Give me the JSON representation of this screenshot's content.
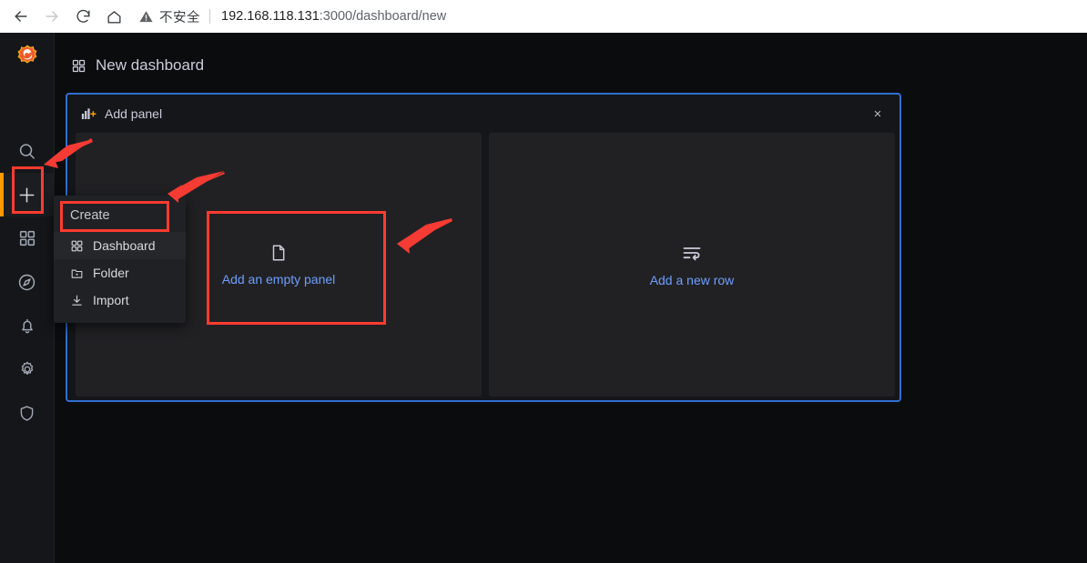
{
  "browser": {
    "back_icon": "arrow-left-icon",
    "forward_icon": "arrow-right-icon",
    "reload_icon": "reload-icon",
    "home_icon": "home-icon",
    "security_icon": "warning-triangle-icon",
    "security_label": "不安全",
    "url_host": "192.168.118.131",
    "url_port": ":3000",
    "url_path": "/dashboard/new",
    "url_full": "192.168.118.131:3000/dashboard/new"
  },
  "sidebar": {
    "brand": "grafana-logo",
    "items": [
      {
        "name": "search",
        "icon": "search-icon",
        "label": "Search",
        "active": false
      },
      {
        "name": "create",
        "icon": "plus-icon",
        "label": "Create",
        "active": true
      },
      {
        "name": "dashboards",
        "icon": "apps-grid-icon",
        "label": "Dashboards",
        "active": false
      },
      {
        "name": "explore",
        "icon": "compass-icon",
        "label": "Explore",
        "active": false
      },
      {
        "name": "alerting",
        "icon": "bell-icon",
        "label": "Alerting",
        "active": false
      },
      {
        "name": "configuration",
        "icon": "gear-icon",
        "label": "Configuration",
        "active": false
      },
      {
        "name": "server-admin",
        "icon": "shield-icon",
        "label": "Server Admin",
        "active": false
      }
    ]
  },
  "dashboard": {
    "icon": "apps-grid-icon",
    "title": "New dashboard"
  },
  "add_panel": {
    "icon": "bar-chart-plus-icon",
    "title": "Add panel",
    "close_icon": "close-icon",
    "close_label": "×",
    "options": [
      {
        "name": "add-empty-panel",
        "icon": "file-blank-icon",
        "label": "Add an empty panel"
      },
      {
        "name": "add-new-row",
        "icon": "wrap-text-icon",
        "label": "Add a new row"
      }
    ],
    "border_color": "#2f6fd0"
  },
  "create_menu": {
    "title": "Create",
    "items": [
      {
        "name": "dashboard",
        "icon": "apps-grid-icon",
        "label": "Dashboard",
        "hovered": true
      },
      {
        "name": "folder",
        "icon": "folder-plus-icon",
        "label": "Folder",
        "hovered": false
      },
      {
        "name": "import",
        "icon": "import-icon",
        "label": "Import",
        "hovered": false
      }
    ]
  },
  "annotations": {
    "color": "#ff3b30",
    "highlights": [
      {
        "name": "highlight-create-nav-icon"
      },
      {
        "name": "highlight-dashboard-menu-item"
      },
      {
        "name": "highlight-add-empty-panel"
      }
    ],
    "arrows": [
      {
        "name": "arrow-to-create-nav-icon"
      },
      {
        "name": "arrow-to-create-menu"
      },
      {
        "name": "arrow-to-add-empty-panel"
      }
    ]
  },
  "colors": {
    "accent_orange": "#ff9900",
    "panel_border_blue": "#2f6fd0",
    "link_blue": "#6e9fff",
    "annotation_red": "#ff3b30",
    "app_bg": "#0b0c0e",
    "nav_bg": "#141619",
    "card_bg": "#212124"
  }
}
